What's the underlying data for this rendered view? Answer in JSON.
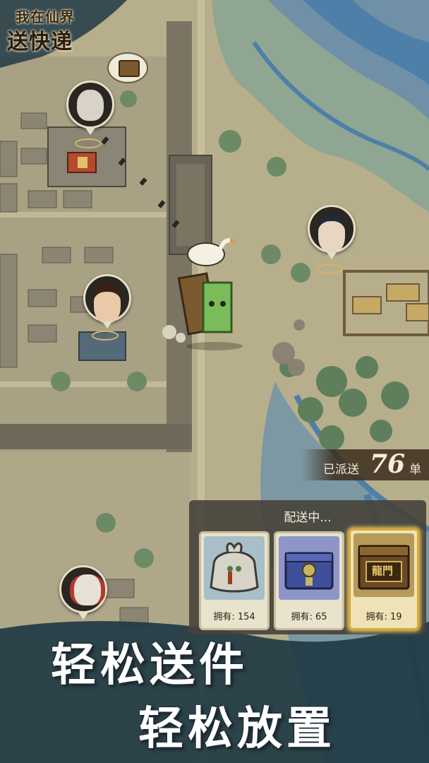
{
  "logo": {
    "line1": "我在仙界",
    "line2": "送快递"
  },
  "counter": {
    "label": "已派送",
    "value": "76",
    "unit": "单"
  },
  "panel": {
    "title": "配送中...",
    "items": [
      {
        "name": "cloth-bundle",
        "count": "拥有: 154"
      },
      {
        "name": "blue-chest",
        "count": "拥有: 65"
      },
      {
        "name": "dragon-gate-chest",
        "count": "拥有: 19",
        "chest_text": "龍門",
        "selected": true
      }
    ]
  },
  "slogan": {
    "line1": "轻松送件",
    "line2": "轻松放置"
  },
  "colors": {
    "accent_gold": "#d6a93b",
    "panel_bg": "#46423a",
    "map_paper": "#b9b08e",
    "river": "#4e7fa8"
  }
}
